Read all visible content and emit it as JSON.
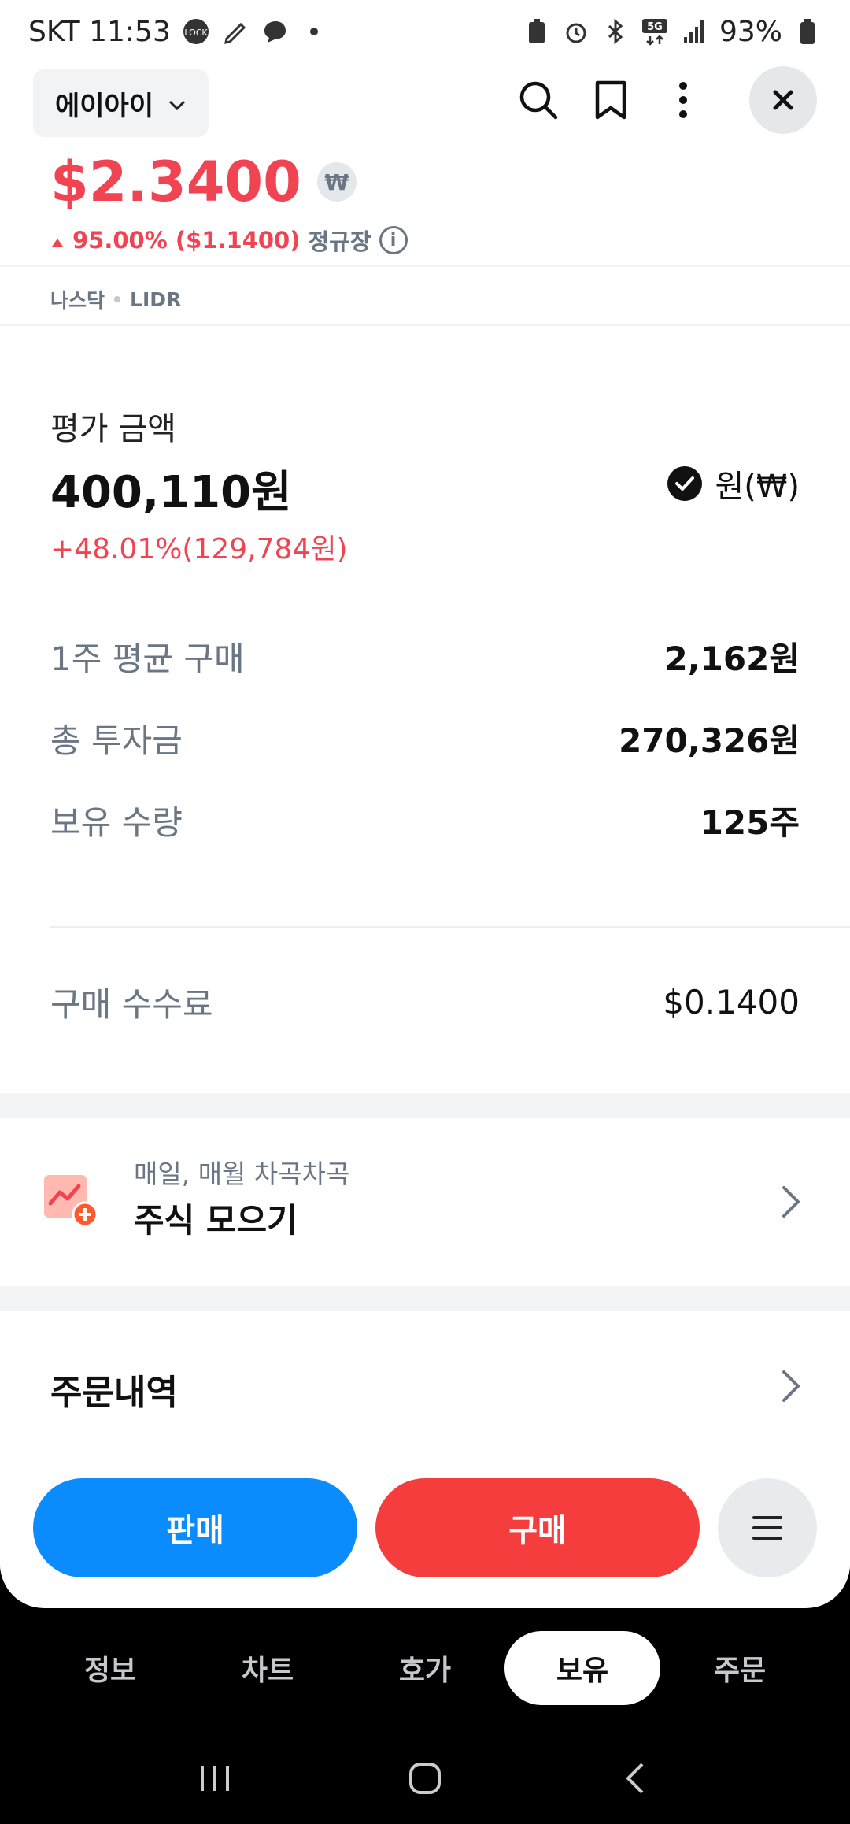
{
  "status_bar": {
    "carrier_time": "SKT 11:53",
    "battery": "93%",
    "network": "5G"
  },
  "header": {
    "stock_name": "에이아이"
  },
  "price": {
    "current": "$2.3400",
    "currency_badge": "₩",
    "change": "95.00% ($1.1400)",
    "market_state": "정규장"
  },
  "exchange": {
    "market": "나스닥",
    "ticker": "LIDR"
  },
  "holding": {
    "eval_label": "평가 금액",
    "eval_value": "400,110원",
    "eval_change": "+48.01%(129,784원)",
    "currency_toggle": "원(₩)",
    "rows": [
      {
        "label": "1주 평균 구매",
        "value": "2,162원"
      },
      {
        "label": "총 투자금",
        "value": "270,326원"
      },
      {
        "label": "보유 수량",
        "value": "125주"
      }
    ],
    "fee_label": "구매 수수료",
    "fee_value": "$0.1400"
  },
  "collect": {
    "subtitle": "매일, 매월 차곡차곡",
    "title": "주식 모으기"
  },
  "orders": {
    "title": "주문내역"
  },
  "actions": {
    "sell": "판매",
    "buy": "구매"
  },
  "tabs": [
    {
      "label": "정보",
      "active": false
    },
    {
      "label": "차트",
      "active": false
    },
    {
      "label": "호가",
      "active": false
    },
    {
      "label": "보유",
      "active": true
    },
    {
      "label": "주문",
      "active": false
    }
  ],
  "colors": {
    "up_red": "#f04452",
    "sell_blue": "#0a8cff",
    "buy_red": "#f53d3d"
  }
}
